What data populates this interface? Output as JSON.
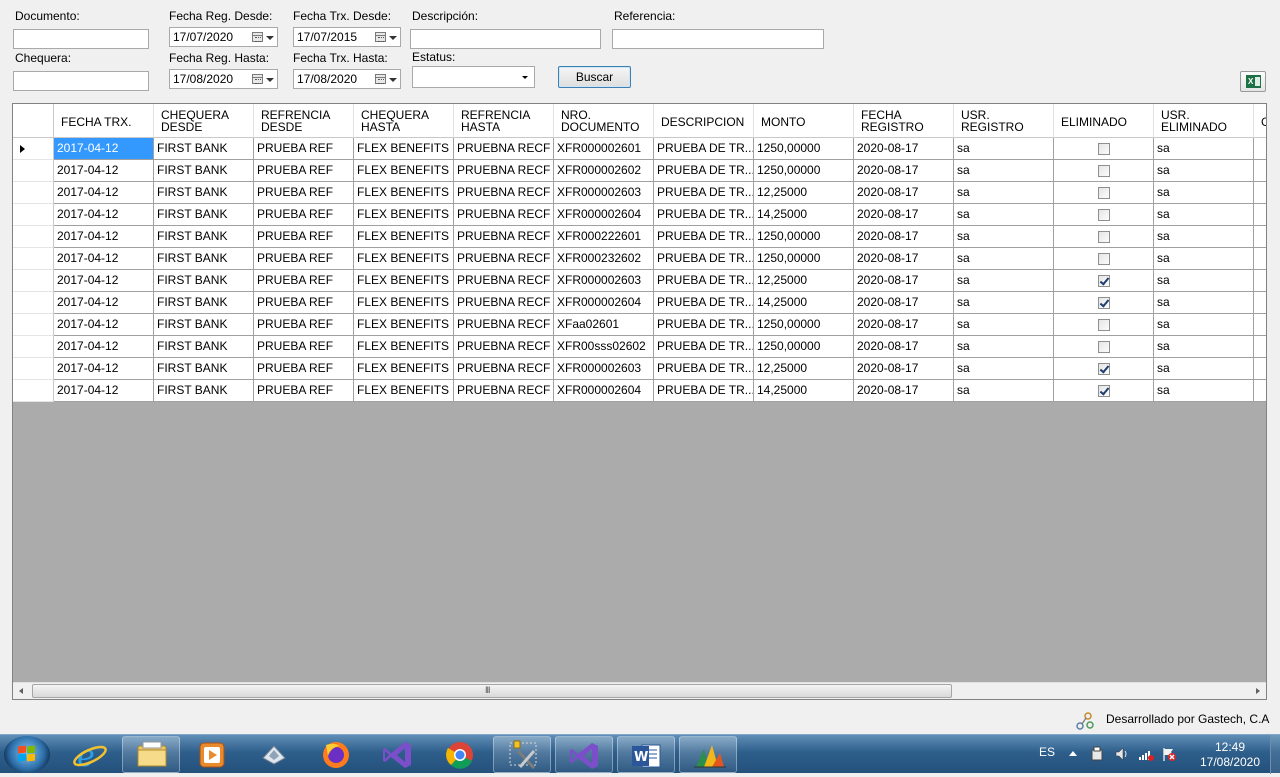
{
  "filters": {
    "documento_label": "Documento:",
    "chequera_label": "Chequera:",
    "fecha_reg_desde_label": "Fecha Reg. Desde:",
    "fecha_reg_desde_value": "17/07/2020",
    "fecha_reg_hasta_label": "Fecha Reg. Hasta:",
    "fecha_reg_hasta_value": "17/08/2020",
    "fecha_trx_desde_label": "Fecha Trx. Desde:",
    "fecha_trx_desde_value": "17/07/2015",
    "fecha_trx_hasta_label": "Fecha Trx. Hasta:",
    "fecha_trx_hasta_value": "17/08/2020",
    "descripcion_label": "Descripción:",
    "estatus_label": "Estatus:",
    "referencia_label": "Referencia:",
    "buscar_label": "Buscar"
  },
  "grid": {
    "headers": [
      "FECHA TRX.",
      "CHEQUERA\nDESDE",
      "REFRENCIA\nDESDE",
      "CHEQUERA\nHASTA",
      "REFRENCIA\nHASTA",
      "NRO.\nDOCUMENTO",
      "DESCRIPCION",
      "MONTO",
      "FECHA\nREGISTRO",
      "USR.\nREGISTRO",
      "ELIMINADO",
      "USR.\nELIMINADO",
      "G"
    ],
    "rows": [
      {
        "fecha_trx": "2017-04-12",
        "chequera_desde": "FIRST BANK",
        "ref_desde": "PRUEBA REF",
        "chequera_hasta": "FLEX BENEFITS",
        "ref_hasta": "PRUEBNA RECF",
        "nro_documento": "XFR000002601",
        "descripcion": "PRUEBA DE TR...",
        "monto": "1250,00000",
        "fecha_registro": "2020-08-17",
        "usr_registro": "sa",
        "eliminado": false,
        "usr_eliminado": "sa"
      },
      {
        "fecha_trx": "2017-04-12",
        "chequera_desde": "FIRST BANK",
        "ref_desde": "PRUEBA REF",
        "chequera_hasta": "FLEX BENEFITS",
        "ref_hasta": "PRUEBNA RECF",
        "nro_documento": "XFR000002602",
        "descripcion": "PRUEBA DE TR...",
        "monto": "1250,00000",
        "fecha_registro": "2020-08-17",
        "usr_registro": "sa",
        "eliminado": false,
        "usr_eliminado": "sa"
      },
      {
        "fecha_trx": "2017-04-12",
        "chequera_desde": "FIRST BANK",
        "ref_desde": "PRUEBA REF",
        "chequera_hasta": "FLEX BENEFITS",
        "ref_hasta": "PRUEBNA RECF",
        "nro_documento": "XFR000002603",
        "descripcion": "PRUEBA DE TR...",
        "monto": "12,25000",
        "fecha_registro": "2020-08-17",
        "usr_registro": "sa",
        "eliminado": false,
        "usr_eliminado": "sa"
      },
      {
        "fecha_trx": "2017-04-12",
        "chequera_desde": "FIRST BANK",
        "ref_desde": "PRUEBA REF",
        "chequera_hasta": "FLEX BENEFITS",
        "ref_hasta": "PRUEBNA RECF",
        "nro_documento": "XFR000002604",
        "descripcion": "PRUEBA DE TR...",
        "monto": "14,25000",
        "fecha_registro": "2020-08-17",
        "usr_registro": "sa",
        "eliminado": false,
        "usr_eliminado": "sa"
      },
      {
        "fecha_trx": "2017-04-12",
        "chequera_desde": "FIRST BANK",
        "ref_desde": "PRUEBA REF",
        "chequera_hasta": "FLEX BENEFITS",
        "ref_hasta": "PRUEBNA RECF",
        "nro_documento": "XFR000222601",
        "descripcion": "PRUEBA DE TR...",
        "monto": "1250,00000",
        "fecha_registro": "2020-08-17",
        "usr_registro": "sa",
        "eliminado": false,
        "usr_eliminado": "sa"
      },
      {
        "fecha_trx": "2017-04-12",
        "chequera_desde": "FIRST BANK",
        "ref_desde": "PRUEBA REF",
        "chequera_hasta": "FLEX BENEFITS",
        "ref_hasta": "PRUEBNA RECF",
        "nro_documento": "XFR000232602",
        "descripcion": "PRUEBA DE TR...",
        "monto": "1250,00000",
        "fecha_registro": "2020-08-17",
        "usr_registro": "sa",
        "eliminado": false,
        "usr_eliminado": "sa"
      },
      {
        "fecha_trx": "2017-04-12",
        "chequera_desde": "FIRST BANK",
        "ref_desde": "PRUEBA REF",
        "chequera_hasta": "FLEX BENEFITS",
        "ref_hasta": "PRUEBNA RECF",
        "nro_documento": "XFR000002603",
        "descripcion": "PRUEBA DE TR...",
        "monto": "12,25000",
        "fecha_registro": "2020-08-17",
        "usr_registro": "sa",
        "eliminado": true,
        "usr_eliminado": "sa"
      },
      {
        "fecha_trx": "2017-04-12",
        "chequera_desde": "FIRST BANK",
        "ref_desde": "PRUEBA REF",
        "chequera_hasta": "FLEX BENEFITS",
        "ref_hasta": "PRUEBNA RECF",
        "nro_documento": "XFR000002604",
        "descripcion": "PRUEBA DE TR...",
        "monto": "14,25000",
        "fecha_registro": "2020-08-17",
        "usr_registro": "sa",
        "eliminado": true,
        "usr_eliminado": "sa"
      },
      {
        "fecha_trx": "2017-04-12",
        "chequera_desde": "FIRST BANK",
        "ref_desde": "PRUEBA REF",
        "chequera_hasta": "FLEX BENEFITS",
        "ref_hasta": "PRUEBNA RECF",
        "nro_documento": "XFaa02601",
        "descripcion": "PRUEBA DE TR...",
        "monto": "1250,00000",
        "fecha_registro": "2020-08-17",
        "usr_registro": "sa",
        "eliminado": false,
        "usr_eliminado": "sa"
      },
      {
        "fecha_trx": "2017-04-12",
        "chequera_desde": "FIRST BANK",
        "ref_desde": "PRUEBA REF",
        "chequera_hasta": "FLEX BENEFITS",
        "ref_hasta": "PRUEBNA RECF",
        "nro_documento": "XFR00sss02602",
        "descripcion": "PRUEBA DE TR...",
        "monto": "1250,00000",
        "fecha_registro": "2020-08-17",
        "usr_registro": "sa",
        "eliminado": false,
        "usr_eliminado": "sa"
      },
      {
        "fecha_trx": "2017-04-12",
        "chequera_desde": "FIRST BANK",
        "ref_desde": "PRUEBA REF",
        "chequera_hasta": "FLEX BENEFITS",
        "ref_hasta": "PRUEBNA RECF",
        "nro_documento": "XFR000002603",
        "descripcion": "PRUEBA DE TR...",
        "monto": "12,25000",
        "fecha_registro": "2020-08-17",
        "usr_registro": "sa",
        "eliminado": true,
        "usr_eliminado": "sa"
      },
      {
        "fecha_trx": "2017-04-12",
        "chequera_desde": "FIRST BANK",
        "ref_desde": "PRUEBA REF",
        "chequera_hasta": "FLEX BENEFITS",
        "ref_hasta": "PRUEBNA RECF",
        "nro_documento": "XFR000002604",
        "descripcion": "PRUEBA DE TR...",
        "monto": "14,25000",
        "fecha_registro": "2020-08-17",
        "usr_registro": "sa",
        "eliminado": true,
        "usr_eliminado": "sa"
      }
    ],
    "selected_row": 0
  },
  "footer": {
    "credit": "Desarrollado por Gastech, C.A"
  },
  "taskbar": {
    "apps": [
      "start-icon",
      "internet-explorer-icon",
      "file-explorer-icon",
      "media-player-icon",
      "app-icon",
      "firefox-icon",
      "visual-studio-icon",
      "chrome-icon",
      "tools-icon",
      "visual-studio-icon",
      "word-icon",
      "dynamics-icon"
    ],
    "language": "ES",
    "time": "12:49",
    "date": "17/08/2020"
  },
  "colors": {
    "selection": "#3399ff",
    "grid_background": "#ababab",
    "taskbar": "#2e5e8b"
  }
}
